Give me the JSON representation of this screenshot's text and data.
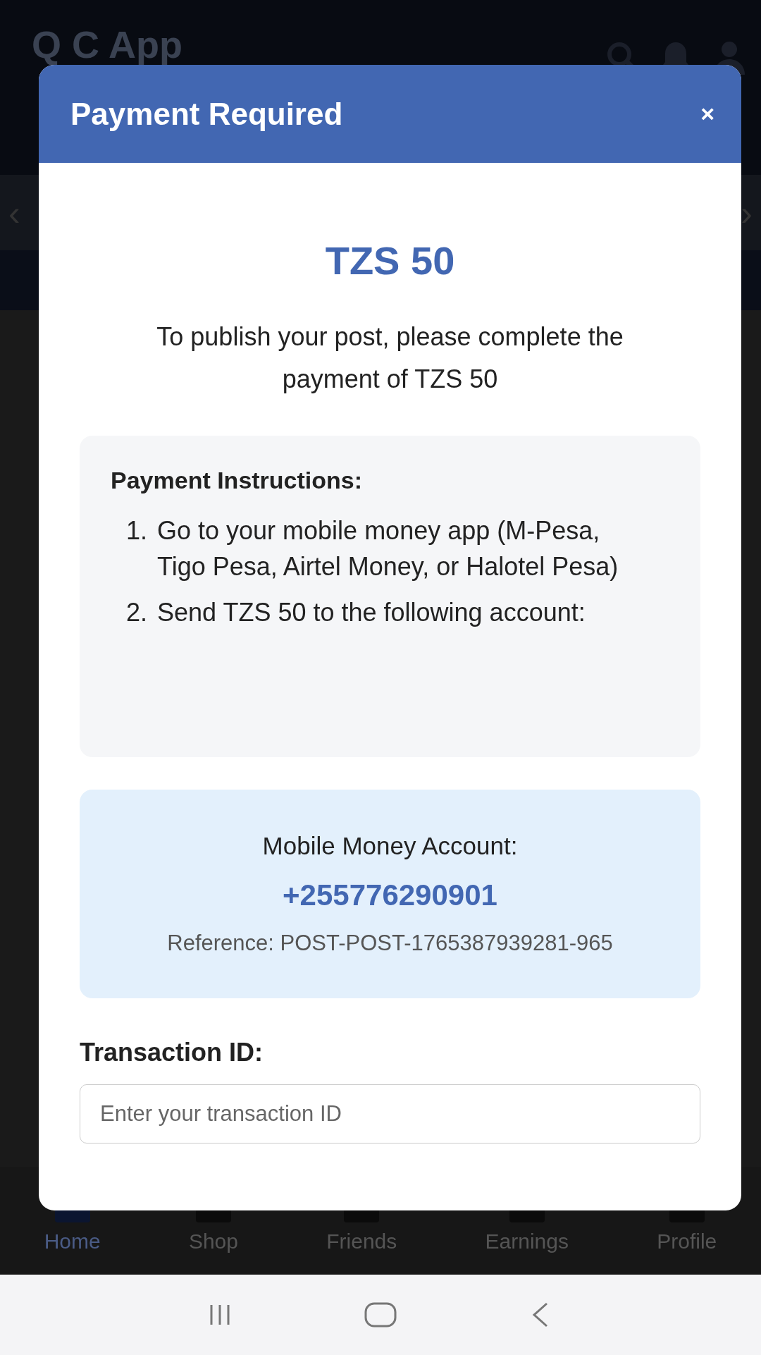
{
  "app_bar": {
    "title": "Q C App"
  },
  "carousel": {
    "prev": "‹",
    "next": "›"
  },
  "bottom_nav": [
    {
      "label": "Home",
      "selected": true
    },
    {
      "label": "Shop",
      "selected": false
    },
    {
      "label": "Friends",
      "selected": false
    },
    {
      "label": "Earnings",
      "selected": false
    },
    {
      "label": "Profile",
      "selected": false
    }
  ],
  "modal": {
    "title": "Payment Required",
    "close": "×",
    "amount": "TZS 50",
    "message": "To publish your post, please complete the payment of TZS 50",
    "instructions": {
      "heading": "Payment Instructions:",
      "steps": [
        {
          "number": "1.",
          "text": "Go to your mobile money app (M-Pesa, Tigo Pesa, Airtel Money, or Halotel Pesa)"
        },
        {
          "number": "2.",
          "text": "Send TZS 50 to the following account:"
        }
      ]
    },
    "account": {
      "label": "Mobile Money Account:",
      "number": "+255776290901",
      "reference": "Reference: POST-POST-1765387939281-965"
    },
    "transaction": {
      "label": "Transaction ID:",
      "placeholder": "Enter your transaction ID"
    }
  }
}
